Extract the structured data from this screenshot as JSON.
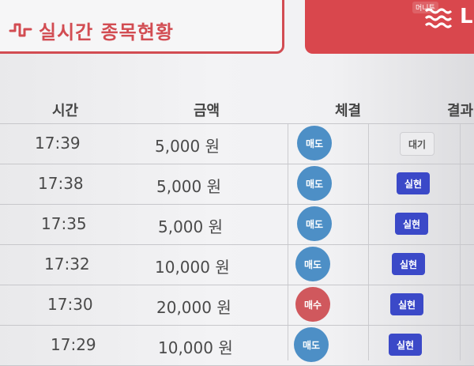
{
  "header": {
    "realtime_button_label": "실시간 종목현황",
    "right_button_glyph": "L",
    "watermark": "머니투"
  },
  "columns": {
    "time": "시간",
    "amount": "금액",
    "execution": "체결",
    "result": "결과"
  },
  "rows": [
    {
      "time": "17:39",
      "amount": "5,000 원",
      "execution": "매도",
      "execution_type": "sell",
      "result": "대기",
      "result_type": "pending"
    },
    {
      "time": "17:38",
      "amount": "5,000 원",
      "execution": "매도",
      "execution_type": "sell",
      "result": "실현",
      "result_type": "done"
    },
    {
      "time": "17:35",
      "amount": "5,000 원",
      "execution": "매도",
      "execution_type": "sell",
      "result": "실현",
      "result_type": "done"
    },
    {
      "time": "17:32",
      "amount": "10,000 원",
      "execution": "매도",
      "execution_type": "sell",
      "result": "실현",
      "result_type": "done"
    },
    {
      "time": "17:30",
      "amount": "20,000 원",
      "execution": "매수",
      "execution_type": "buy",
      "result": "실현",
      "result_type": "done"
    },
    {
      "time": "17:29",
      "amount": "10,000 원",
      "execution": "매도",
      "execution_type": "sell",
      "result": "실현",
      "result_type": "done"
    }
  ],
  "colors": {
    "accent_red": "#d9474d",
    "sell_blue": "#4d8fc6",
    "buy_red": "#d0585d",
    "realized_blue": "#3b49c8"
  },
  "icons": [
    "wave-icon",
    "menu-icon"
  ]
}
